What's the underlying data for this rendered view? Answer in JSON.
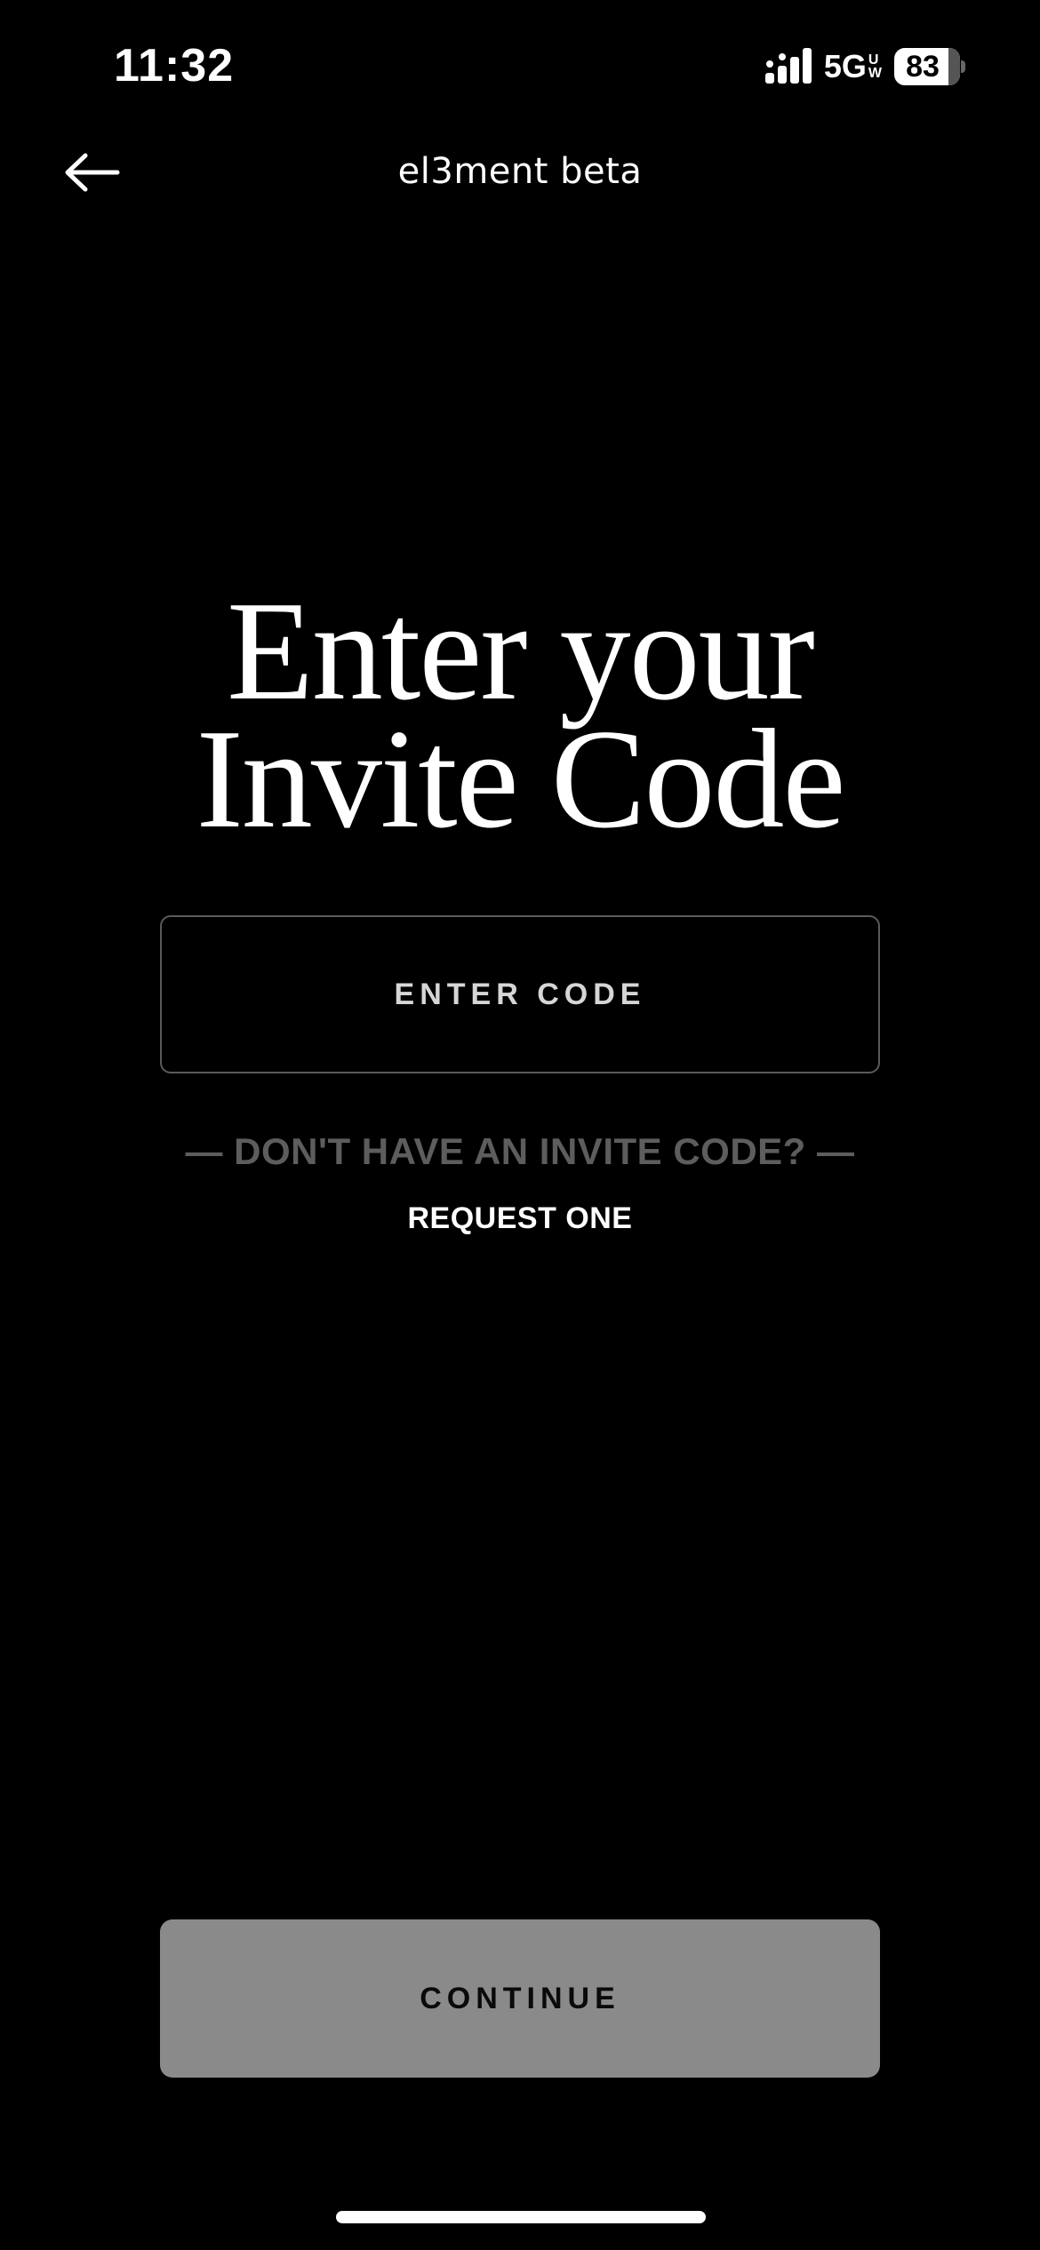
{
  "status_bar": {
    "time": "11:32",
    "network": "5G",
    "network_sub_top": "U",
    "network_sub_bottom": "W",
    "battery_level": "83",
    "battery_fraction": 0.83
  },
  "header": {
    "title": "el3ment beta",
    "back_icon": "arrow-left-icon"
  },
  "main": {
    "heading_line1": "Enter your",
    "heading_line2": "Invite Code",
    "code_input": {
      "placeholder": "ENTER CODE",
      "value": ""
    },
    "invite_prompt": "— DON'T HAVE AN INVITE CODE? —",
    "request_link": "REQUEST ONE"
  },
  "footer": {
    "continue_label": "CONTINUE"
  },
  "colors": {
    "background": "#000000",
    "input_border": "#5a5a5a",
    "muted_text": "#5d5d5d",
    "button_disabled": "#8a8a8a"
  }
}
